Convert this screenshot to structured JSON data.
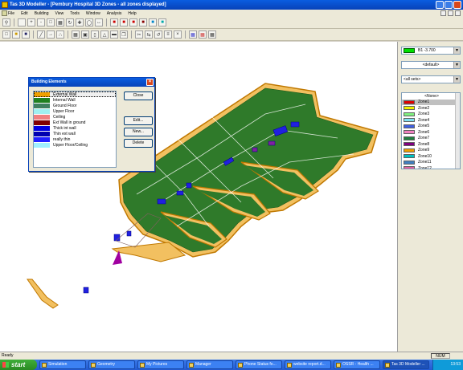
{
  "window": {
    "title": "Tas 3D Modeller - [Pembury Hospital 3D Zones - all zones displayed]"
  },
  "menu": [
    "File",
    "Edit",
    "Building",
    "View",
    "Tools",
    "Window",
    "Analysis",
    "Help"
  ],
  "right_panel": {
    "level_value": "B1    -3.700",
    "view_value": "<default>",
    "set_value": "<all sets>",
    "zones": [
      {
        "name": "<None>",
        "color": "#ffffff"
      },
      {
        "name": "Zone1",
        "color": "#e00000"
      },
      {
        "name": "Zone2",
        "color": "#f0f000"
      },
      {
        "name": "Zone3",
        "color": "#80f080"
      },
      {
        "name": "Zone4",
        "color": "#80e0f0"
      },
      {
        "name": "Zone5",
        "color": "#4060e0"
      },
      {
        "name": "Zone6",
        "color": "#f080c0"
      },
      {
        "name": "Zone7",
        "color": "#208040"
      },
      {
        "name": "Zone8",
        "color": "#800080"
      },
      {
        "name": "Zone9",
        "color": "#f0a000"
      },
      {
        "name": "Zone10",
        "color": "#00c0c0"
      },
      {
        "name": "Zone11",
        "color": "#4080c0"
      },
      {
        "name": "Zone12",
        "color": "#e060a0"
      }
    ]
  },
  "dialog": {
    "title": "Building Elements",
    "elements": [
      {
        "name": "External Wall",
        "color": "#f0a000"
      },
      {
        "name": "Internal Wall",
        "color": "#208020"
      },
      {
        "name": "Ground Floor",
        "color": "#408060"
      },
      {
        "name": "Upper Floor",
        "color": "#a0f0f0"
      },
      {
        "name": "Ceiling",
        "color": "#f08080"
      },
      {
        "name": "Ext Wall in ground",
        "color": "#800000"
      },
      {
        "name": "Thick int wall",
        "color": "#0000e0"
      },
      {
        "name": "Thin ext wall",
        "color": "#0000b0"
      },
      {
        "name": "really thin",
        "color": "#2020ff"
      },
      {
        "name": "Upper Floor/Ceiling",
        "color": "#a0f0ff"
      }
    ],
    "buttons": {
      "close": "Close",
      "edit": "Edit...",
      "new": "New...",
      "delete": "Delete"
    }
  },
  "status": {
    "text": "Ready",
    "num": "NUM"
  },
  "taskbar": {
    "start": "start",
    "tasks": [
      "Simulation",
      "Geometry",
      "My Pictures",
      "Manager",
      "Phone Status fo...",
      "website report.d...",
      "OSSR - Health ...",
      "Tas 3D Modeller ..."
    ],
    "clock": "13:53"
  }
}
